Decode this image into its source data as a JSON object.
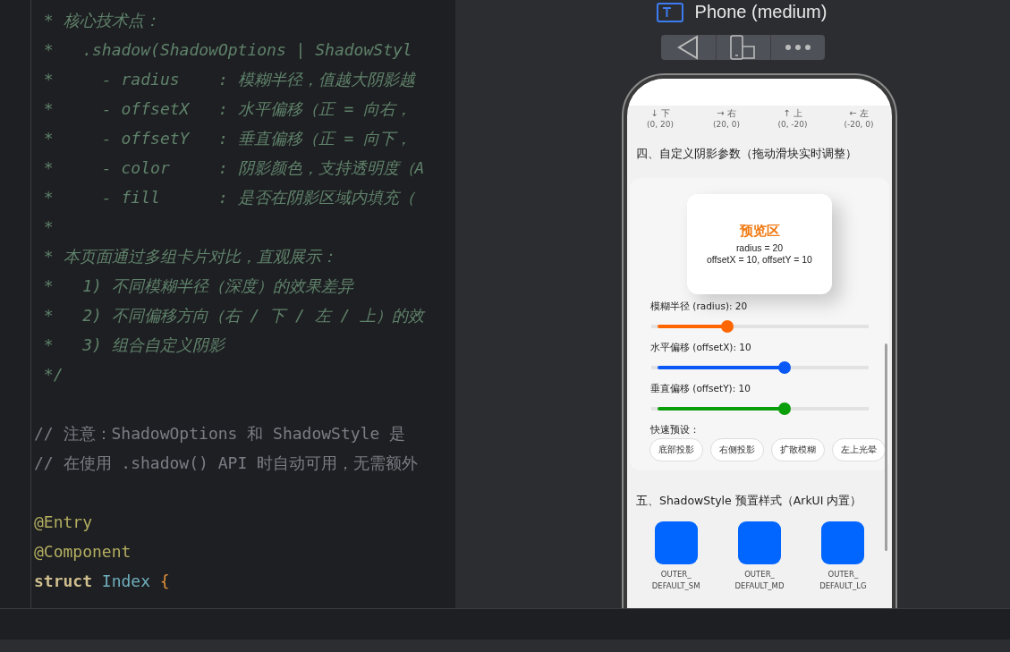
{
  "editor": {
    "lines": [
      {
        "segments": [
          {
            "kind": "doc",
            "text": " * 核心技术点："
          }
        ]
      },
      {
        "segments": [
          {
            "kind": "doc",
            "text": " *   .shadow(ShadowOptions | ShadowStyl"
          }
        ]
      },
      {
        "segments": [
          {
            "kind": "doc",
            "text": " *     - radius    : 模糊半径，值越大阴影越"
          }
        ]
      },
      {
        "segments": [
          {
            "kind": "doc",
            "text": " *     - offsetX   : 水平偏移（正 = 向右，"
          }
        ]
      },
      {
        "segments": [
          {
            "kind": "doc",
            "text": " *     - offsetY   : 垂直偏移（正 = 向下，"
          }
        ]
      },
      {
        "segments": [
          {
            "kind": "doc",
            "text": " *     - color     : 阴影颜色，支持透明度（A"
          }
        ]
      },
      {
        "segments": [
          {
            "kind": "doc",
            "text": " *     - fill      : 是否在阴影区域内填充（"
          }
        ]
      },
      {
        "segments": [
          {
            "kind": "doc",
            "text": " *"
          }
        ]
      },
      {
        "segments": [
          {
            "kind": "doc",
            "text": " * 本页面通过多组卡片对比，直观展示："
          }
        ]
      },
      {
        "segments": [
          {
            "kind": "doc",
            "text": " *   1) 不同模糊半径（深度）的效果差异"
          }
        ]
      },
      {
        "segments": [
          {
            "kind": "doc",
            "text": " *   2) 不同偏移方向（右 / 下 / 左 / 上）的效"
          }
        ]
      },
      {
        "segments": [
          {
            "kind": "doc",
            "text": " *   3) 组合自定义阴影"
          }
        ]
      },
      {
        "segments": [
          {
            "kind": "doc",
            "text": " */"
          }
        ]
      },
      {
        "blank_before": true,
        "segments": [
          {
            "kind": "comment",
            "text": "// 注意：ShadowOptions 和 ShadowStyle 是"
          }
        ]
      },
      {
        "segments": [
          {
            "kind": "comment",
            "text": "// 在使用 .shadow() API 时自动可用，无需额外"
          }
        ]
      },
      {
        "blank_before": true,
        "segments": [
          {
            "kind": "annotation",
            "text": "@Entry"
          }
        ]
      },
      {
        "segments": [
          {
            "kind": "annotation",
            "text": "@Component"
          }
        ]
      },
      {
        "segments": [
          {
            "kind": "keyword",
            "text": "struct"
          },
          {
            "kind": "type",
            "text": "Index"
          },
          {
            "kind": "brace",
            "text": "{"
          }
        ]
      }
    ]
  },
  "preview": {
    "device": "Phone (medium)",
    "directions": [
      {
        "label": "↓ 下",
        "offset": "(0, 20)"
      },
      {
        "label": "→ 右",
        "offset": "(20, 0)"
      },
      {
        "label": "↑ 上",
        "offset": "(0, -20)"
      },
      {
        "label": "← 左",
        "offset": "(-20, 0)"
      }
    ],
    "custom_section": {
      "title": "四、自定义阴影参数（拖动滑块实时调整）",
      "preview_card": {
        "title": "预览区",
        "line_1": "radius = 20",
        "line_2": "offsetX = 10, offsetY = 10"
      },
      "sliders": [
        {
          "label": "模糊半径 (radius): 20",
          "level": 0.34,
          "color": "#ff6600"
        },
        {
          "label": "水平偏移 (offsetX): 10",
          "level": 0.62,
          "color": "#0a59f7"
        },
        {
          "label": "垂直偏移 (offsetY): 10",
          "level": 0.62,
          "color": "#0a9e0a"
        }
      ],
      "presets_label": "快速预设：",
      "presets": [
        "底部投影",
        "右侧投影",
        "扩散模糊",
        "左上光晕"
      ]
    },
    "style_section": {
      "title": "五、ShadowStyle 预置样式（ArkUI 内置）",
      "items": [
        "OUTER_\nDEFAULT_SM",
        "OUTER_\nDEFAULT_MD",
        "OUTER_\nDEFAULT_LG"
      ]
    }
  }
}
